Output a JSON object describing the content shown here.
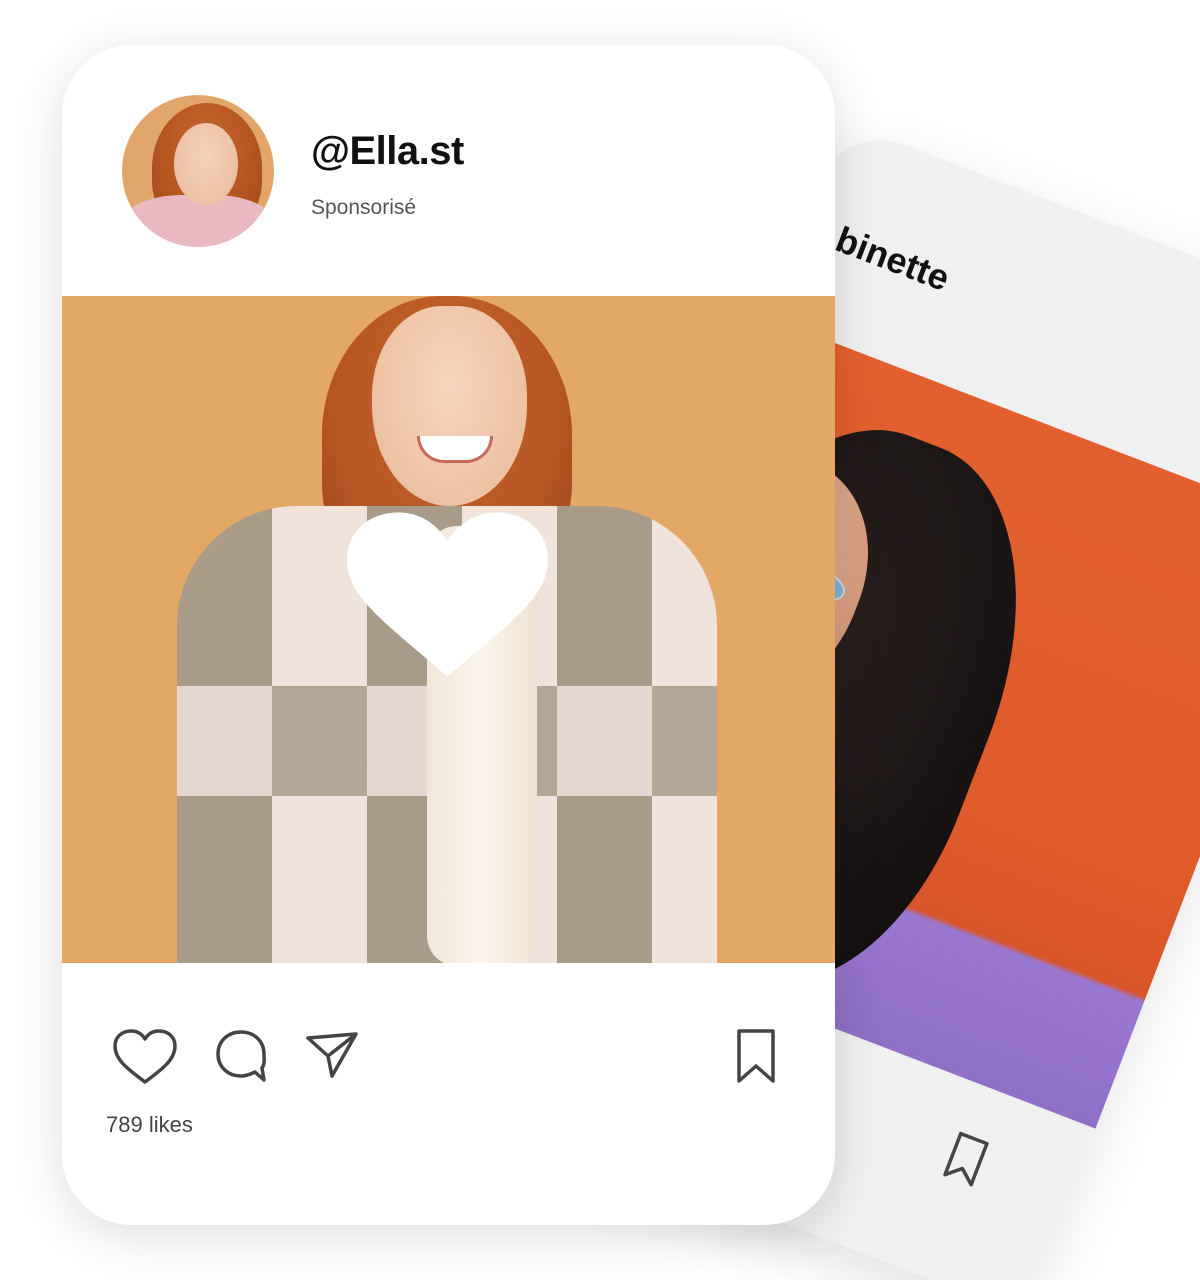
{
  "front_post": {
    "handle": "@Ella.st",
    "label": "Sponsorisé",
    "likes_text": "789 likes",
    "icons": [
      "heart-icon",
      "comment-icon",
      "send-icon",
      "bookmark-icon",
      "double-tap-heart-icon"
    ],
    "colors": {
      "photo_background": "#e4a866",
      "text_primary": "#111111",
      "text_secondary": "#555555"
    }
  },
  "back_post": {
    "handle_fragment": "binette",
    "icons": [
      "bookmark-icon"
    ],
    "colors": {
      "card_background": "#f0f0f0",
      "photo_background": "#e05a2a"
    }
  }
}
